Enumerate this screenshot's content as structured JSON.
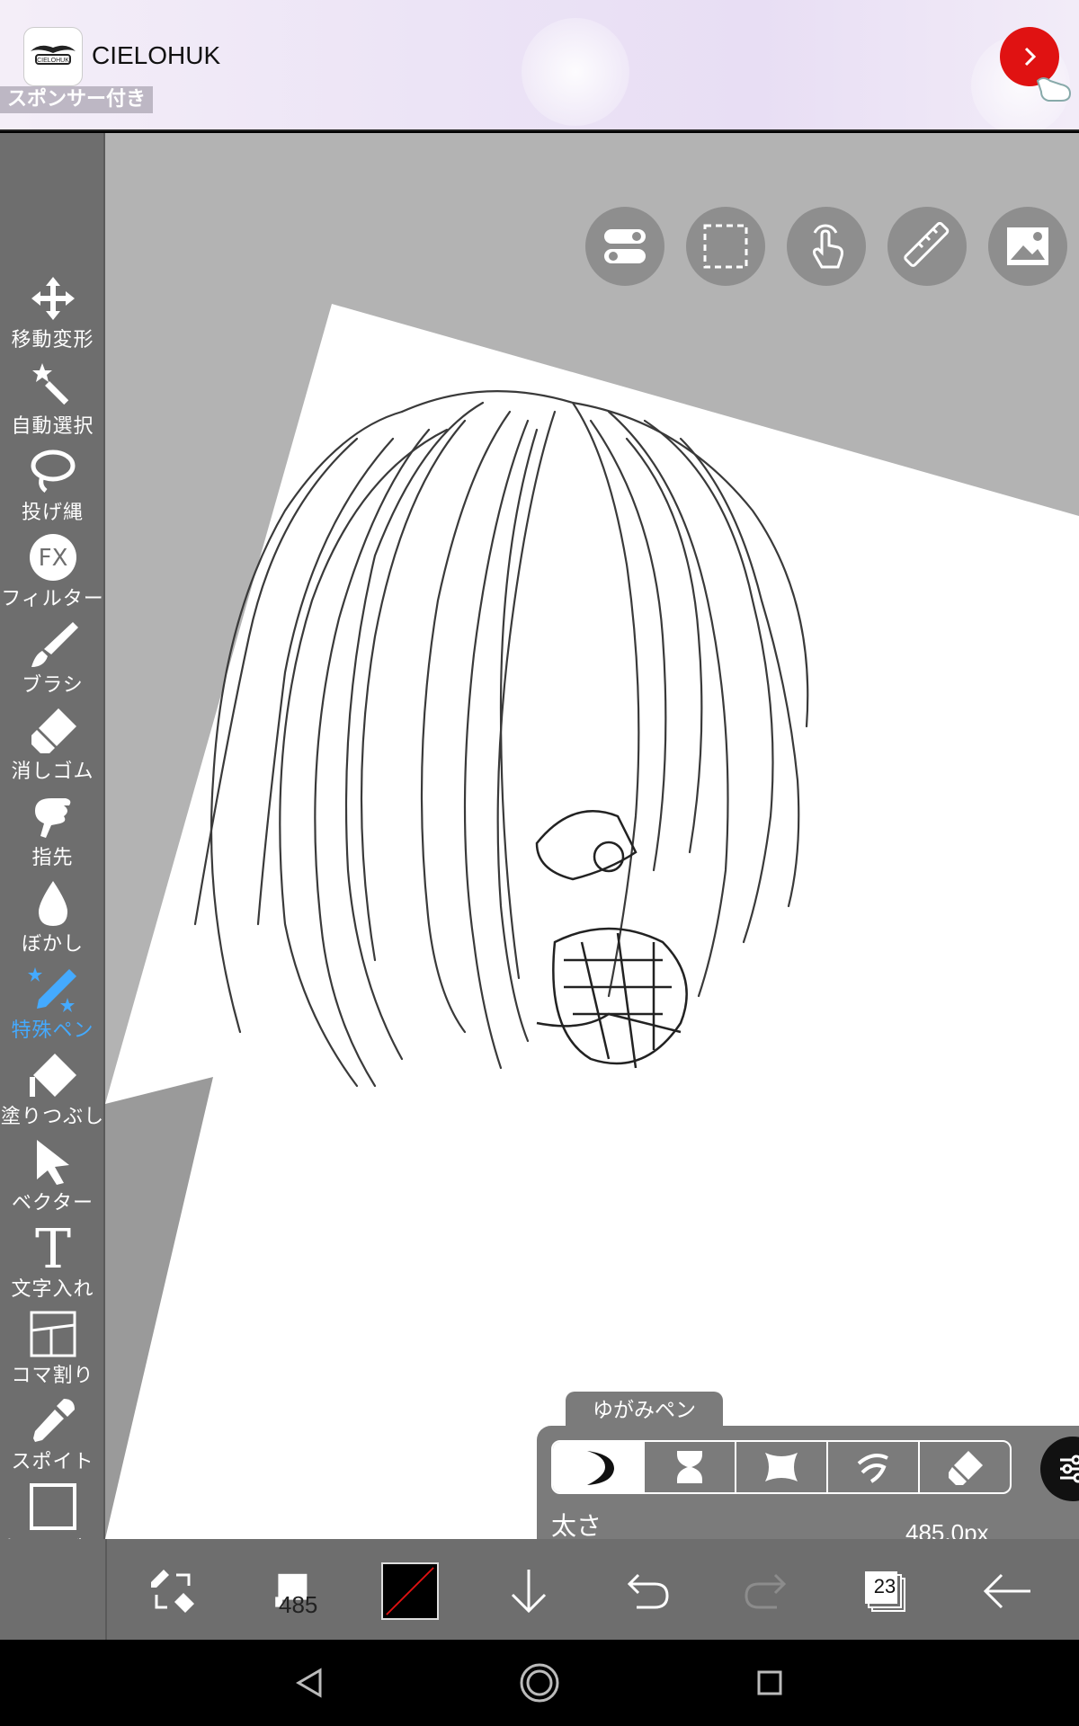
{
  "ad": {
    "title": "CIELOHUK",
    "sponsor_label": "スポンサー付き",
    "logo_text": "CIELOHUK"
  },
  "tools": [
    {
      "label": "移動変形",
      "icon": "move-icon",
      "active": false
    },
    {
      "label": "自動選択",
      "icon": "magic-wand-icon",
      "active": false
    },
    {
      "label": "投げ縄",
      "icon": "lasso-icon",
      "active": false
    },
    {
      "label": "フィルター",
      "icon": "fx-icon",
      "active": false
    },
    {
      "label": "ブラシ",
      "icon": "brush-icon",
      "active": false
    },
    {
      "label": "消しゴム",
      "icon": "eraser-icon",
      "active": false
    },
    {
      "label": "指先",
      "icon": "finger-icon",
      "active": false
    },
    {
      "label": "ぼかし",
      "icon": "blur-drop-icon",
      "active": false
    },
    {
      "label": "特殊ペン",
      "icon": "special-pen-icon",
      "active": true
    },
    {
      "label": "塗りつぶし",
      "icon": "fill-icon",
      "active": false
    },
    {
      "label": "ベクター",
      "icon": "vector-icon",
      "active": false
    },
    {
      "label": "文字入れ",
      "icon": "text-icon",
      "active": false
    },
    {
      "label": "コマ割り",
      "icon": "frame-divider-icon",
      "active": false
    },
    {
      "label": "スポイト",
      "icon": "eyedropper-icon",
      "active": false
    },
    {
      "label": "キャンバス",
      "icon": "canvas-icon",
      "active": false
    }
  ],
  "top_buttons": [
    "toggle-icon",
    "selection-rect-icon",
    "touch-gesture-icon",
    "ruler-icon",
    "image-icon"
  ],
  "brush_panel": {
    "tab_label": "ゆがみペン",
    "size_label": "太さ",
    "size_value": "485.0px",
    "size_fraction": 0.55,
    "modes": [
      "crescent-icon",
      "hourglass-icon",
      "pinch-icon",
      "swirl-icon",
      "eraser-icon"
    ],
    "selected_mode": 0
  },
  "bottom_bar": {
    "brush_size": "485",
    "layer_count": "23",
    "color_accent": "#e01212"
  },
  "colors": {
    "active_tool": "#44aaff",
    "panel_bg": "#7b7b7b",
    "toolbar_bg": "#6e6e6e",
    "slider_fill": "#254f79"
  }
}
